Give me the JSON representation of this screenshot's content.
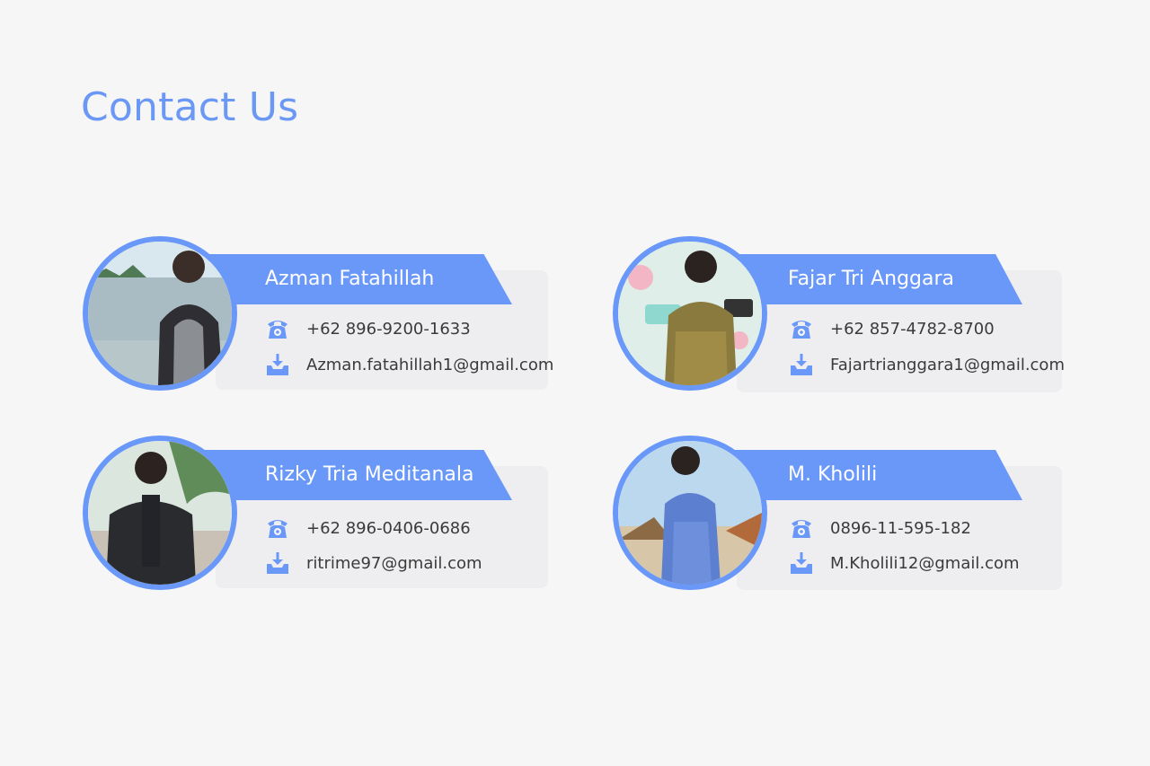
{
  "page": {
    "title": "Contact Us"
  },
  "colors": {
    "accent": "#6a98f8",
    "title": "#6b98f5",
    "background": "#f6f6f7",
    "panel": "#eeeef0"
  },
  "icons": {
    "phone": "phone-icon",
    "email": "download-tray-icon"
  },
  "contacts": [
    {
      "name": "Azman Fatahillah",
      "phone": "+62 896-9200-1633",
      "email": "Azman.fatahillah1@gmail.com"
    },
    {
      "name": "Fajar Tri Anggara",
      "phone": "+62 857-4782-8700",
      "email": "Fajartrianggara1@gmail.com"
    },
    {
      "name": "Rizky Tria Meditanala",
      "phone": "+62 896-0406-0686",
      "email": "ritrime97@gmail.com"
    },
    {
      "name": "M. Kholili",
      "phone": "0896-11-595-182",
      "email": "M.Kholili12@gmail.com"
    }
  ]
}
